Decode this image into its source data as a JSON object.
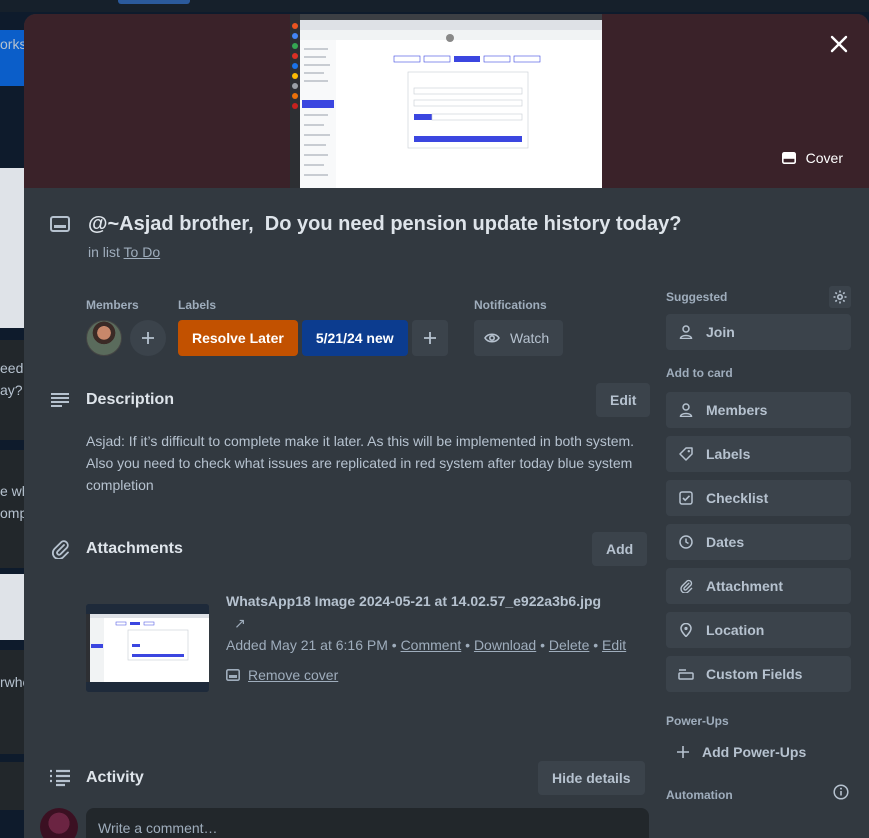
{
  "background": {
    "fragments": [
      "orks",
      "eed",
      "ay?",
      "e wh",
      "omp",
      "rwhe"
    ]
  },
  "cover": {
    "button_label": "Cover",
    "bg_color": "#3a2229"
  },
  "card": {
    "title": "@~Asjad brother,  Do you need pension update history today?",
    "list_prefix": "in list",
    "list_name": "To Do"
  },
  "members": {
    "heading": "Members"
  },
  "labels": {
    "heading": "Labels",
    "items": [
      {
        "text": "Resolve Later",
        "color": "#c25100"
      },
      {
        "text": "5/21/24 new",
        "color": "#0c3c8f"
      }
    ]
  },
  "notifications": {
    "heading": "Notifications",
    "watch_label": "Watch"
  },
  "description": {
    "heading": "Description",
    "edit_label": "Edit",
    "text": "Asjad: If it’s difficult to complete make it later. As this will be implemented in both system. Also you need to check what issues are replicated in red system after today blue system completion"
  },
  "attachments": {
    "heading": "Attachments",
    "add_label": "Add",
    "file_name": "WhatsApp18 Image 2024-05-21 at 14.02.57_e922a3b6.jpg",
    "arrow": "↗",
    "added": "Added May 21 at 6:16 PM",
    "sep": "•",
    "comment": "Comment",
    "download": "Download",
    "delete": "Delete",
    "edit": "Edit",
    "remove_cover": "Remove cover"
  },
  "activity": {
    "heading": "Activity",
    "hide_label": "Hide details",
    "comment_placeholder": "Write a comment…"
  },
  "sidebar": {
    "suggested": "Suggested",
    "join": "Join",
    "add_to_card": "Add to card",
    "buttons": [
      "Members",
      "Labels",
      "Checklist",
      "Dates",
      "Attachment",
      "Location",
      "Custom Fields"
    ],
    "power_ups": "Power-Ups",
    "add_power_ups": "Add Power-Ups",
    "automation": "Automation"
  }
}
